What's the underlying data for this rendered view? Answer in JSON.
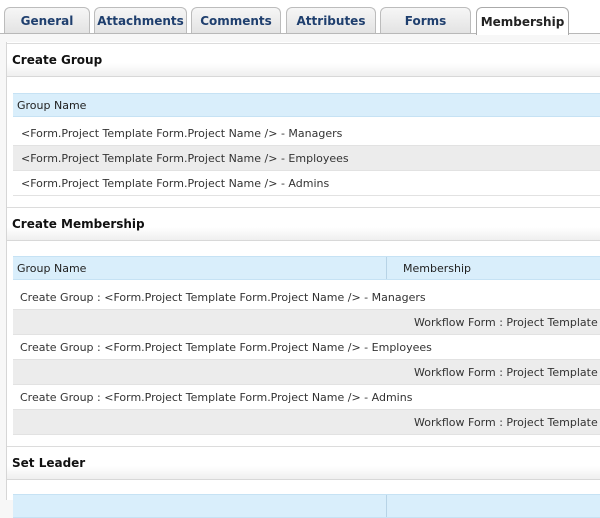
{
  "tabs": [
    "General",
    "Attachments",
    "Comments",
    "Attributes",
    "Forms",
    "Membership"
  ],
  "active_tab": "Membership",
  "create_group": {
    "title": "Create Group",
    "column": "Group Name",
    "rows": [
      "<Form.Project Template Form.Project Name /> - Managers",
      "<Form.Project Template Form.Project Name /> - Employees",
      "<Form.Project Template Form.Project Name /> - Admins"
    ]
  },
  "create_membership": {
    "title": "Create Membership",
    "columns": [
      "Group Name",
      "Membership"
    ],
    "rows": [
      {
        "group": "Create Group : <Form.Project Template Form.Project Name /> - Managers",
        "membership": ""
      },
      {
        "group": "",
        "membership": "Workflow Form : Project Template Form"
      },
      {
        "group": "Create Group : <Form.Project Template Form.Project Name /> - Employees",
        "membership": ""
      },
      {
        "group": "",
        "membership": "Workflow Form : Project Template Form"
      },
      {
        "group": "Create Group : <Form.Project Template Form.Project Name /> - Admins",
        "membership": ""
      },
      {
        "group": "",
        "membership": "Workflow Form : Project Template Form"
      }
    ]
  },
  "set_leader": {
    "title": "Set Leader"
  }
}
